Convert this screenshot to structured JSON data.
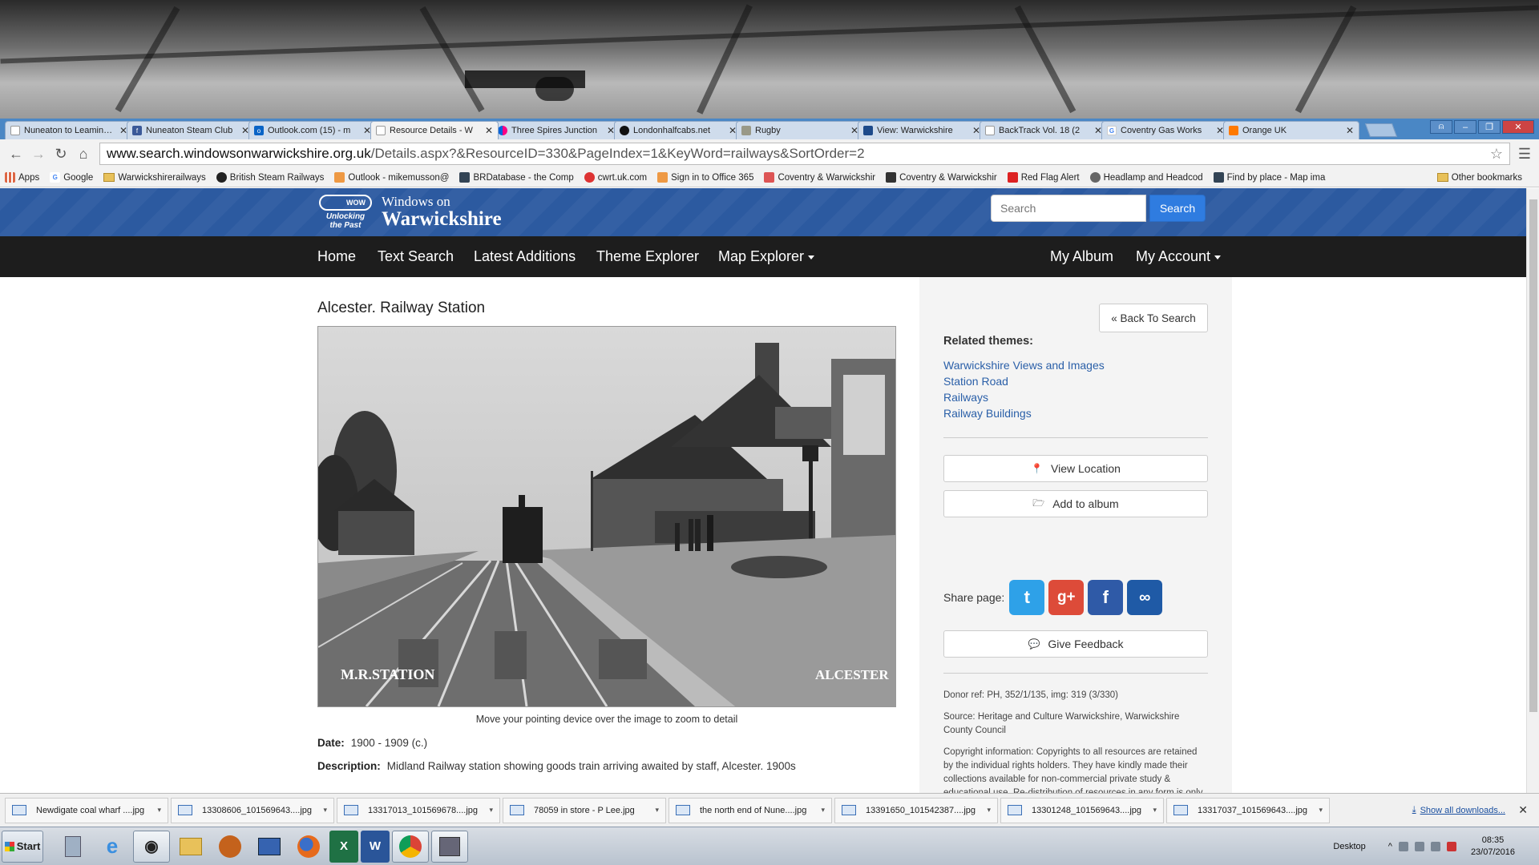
{
  "browser": {
    "tabs": [
      {
        "label": "Nuneaton to Leamington",
        "favicon": "page-icon",
        "active": false
      },
      {
        "label": "Nuneaton Steam Club",
        "favicon": "facebook-icon",
        "active": false
      },
      {
        "label": "Outlook.com (15) - m",
        "favicon": "outlook-icon",
        "active": false
      },
      {
        "label": "Resource Details - W",
        "favicon": "page-icon",
        "active": true
      },
      {
        "label": "Three Spires Junction",
        "favicon": "flickr-icon",
        "active": false
      },
      {
        "label": "Londonhalfcabs.net",
        "favicon": "site-icon",
        "active": false
      },
      {
        "label": "Rugby",
        "favicon": "rugby-icon",
        "active": false
      },
      {
        "label": "View: Warwickshire",
        "favicon": "feather-icon",
        "active": false
      },
      {
        "label": "BackTrack Vol. 18 (2",
        "favicon": "page-icon",
        "active": false
      },
      {
        "label": "Coventry Gas Works",
        "favicon": "google-icon",
        "active": false
      },
      {
        "label": "Orange UK",
        "favicon": "orange-icon",
        "active": false
      }
    ],
    "url_host": "www.search.windowsonwarwickshire.org.uk",
    "url_path": "/Details.aspx?&ResourceID=330&PageIndex=1&KeyWord=railways&SortOrder=2",
    "bookmarks": [
      {
        "label": "Apps",
        "icon": "apps-icon",
        "color": "#d64"
      },
      {
        "label": "Google",
        "icon": "google-icon",
        "color": "#4285f4"
      },
      {
        "label": "Warwickshirerailways",
        "icon": "folder-icon",
        "color": "#e8c15a"
      },
      {
        "label": "British Steam Railways",
        "icon": "site-icon",
        "color": "#222"
      },
      {
        "label": "Outlook - mikemusson@",
        "icon": "office-icon",
        "color": "#e94"
      },
      {
        "label": "BRDatabase - the Comp",
        "icon": "site-icon",
        "color": "#345"
      },
      {
        "label": "cwrt.uk.com",
        "icon": "site-icon",
        "color": "#d33"
      },
      {
        "label": "Sign in to Office 365",
        "icon": "office-icon",
        "color": "#e94"
      },
      {
        "label": "Coventry & Warwickshir",
        "icon": "site-icon",
        "color": "#d55"
      },
      {
        "label": "Coventry & Warwickshir",
        "icon": "site-icon",
        "color": "#333"
      },
      {
        "label": "Red Flag Alert",
        "icon": "flag-icon",
        "color": "#d22"
      },
      {
        "label": "Headlamp and Headcod",
        "icon": "site-icon",
        "color": "#666"
      },
      {
        "label": "Find by place - Map ima",
        "icon": "feather-icon",
        "color": "#345"
      }
    ],
    "other_bookmarks": "Other bookmarks"
  },
  "site": {
    "logo_line1": "Windows on",
    "logo_line2": "Warwickshire",
    "logo_badge": "WOW",
    "logo_tagline": "Unlocking the Past",
    "search_placeholder": "Search",
    "search_button": "Search",
    "nav": {
      "home": "Home",
      "text_search": "Text Search",
      "latest_additions": "Latest Additions",
      "theme_explorer": "Theme Explorer",
      "map_explorer": "Map Explorer",
      "my_album": "My Album",
      "my_account": "My Account"
    }
  },
  "resource": {
    "title": "Alcester. Railway Station",
    "photo_text_left": "M.R.STATION",
    "photo_text_right": "ALCESTER",
    "caption": "Move your pointing device over the image to zoom to detail",
    "date_label": "Date:",
    "date_value": "1900 - 1909 (c.)",
    "description_label": "Description:",
    "description_value": "Midland Railway station showing goods train arriving awaited by staff, Alcester. 1900s"
  },
  "sidebar": {
    "back_button": "« Back To Search",
    "related_heading": "Related themes:",
    "themes": [
      "Warwickshire Views and Images",
      "Station Road",
      "Railways",
      "Railway Buildings"
    ],
    "view_location": "View Location",
    "add_to_album": "Add to album",
    "share_label": "Share page:",
    "share_colors": {
      "twitter": "#2ea1e8",
      "google_plus": "#dd4b39",
      "facebook": "#2f5aa7",
      "link": "#1f5aa6"
    },
    "give_feedback": "Give Feedback",
    "donor_ref": "Donor ref:  PH, 352/1/135, img: 319 (3/330)",
    "source": "Source:   Heritage and Culture Warwickshire, Warwickshire County Council",
    "copyright": "Copyright information: Copyrights to all resources are retained by the individual rights holders. They have kindly made their collections available for non-commercial private study & educational use. Re-distribution of resources in any form is only permitted subject to strict adherence to the usage guidelines."
  },
  "downloads": {
    "items": [
      "Newdigate coal wharf ....jpg",
      "13308606_101569643....jpg",
      "13317013_101569678....jpg",
      "78059 in store - P Lee.jpg",
      "the north end of Nune....jpg",
      "13391650_101542387....jpg",
      "13301248_101569643....jpg",
      "13317037_101569643....jpg"
    ],
    "show_all": "Show all downloads..."
  },
  "taskbar": {
    "start": "Start",
    "desktop": "Desktop",
    "time": "08:35",
    "date": "23/07/2016"
  }
}
